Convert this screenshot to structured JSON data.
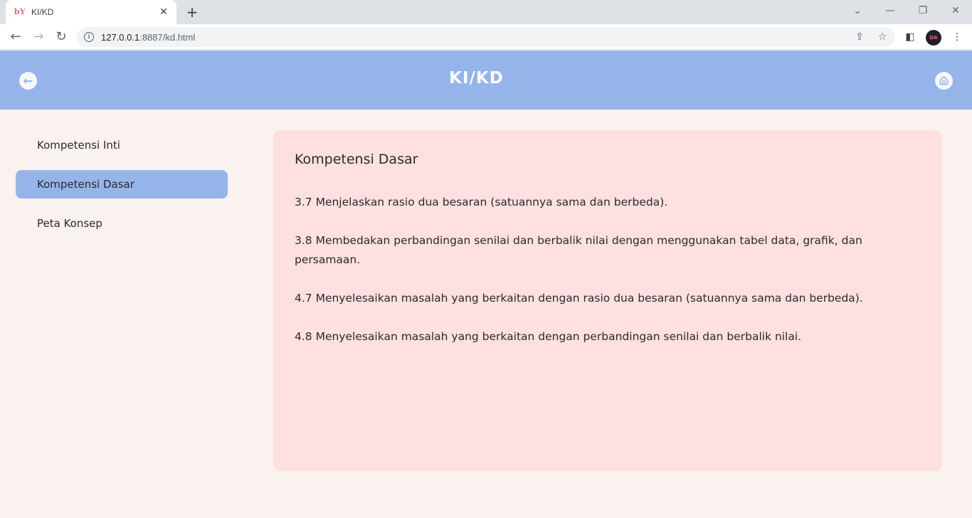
{
  "browser": {
    "tab_title": "KI/KD",
    "favicon_text": "bY",
    "url_host": "127.0.0.1",
    "url_rest": ":8887/kd.html",
    "profile_initials": "DA"
  },
  "header": {
    "title": "KI/KD"
  },
  "sidebar": {
    "items": [
      {
        "label": "Kompetensi Inti"
      },
      {
        "label": "Kompetensi Dasar"
      },
      {
        "label": "Peta Konsep"
      }
    ]
  },
  "content": {
    "title": "Kompetensi Dasar",
    "items": [
      {
        "text": "3.7 Menjelaskan rasio dua besaran (satuannya sama dan berbeda)."
      },
      {
        "text": "3.8 Membedakan perbandingan senilai dan berbalik nilai dengan menggunakan tabel data, grafik, dan persamaan."
      },
      {
        "text": "4.7 Menyelesaikan masalah yang berkaitan dengan rasio dua besaran (satuannya sama dan berbeda)."
      },
      {
        "text": "4.8 Menyelesaikan masalah yang berkaitan dengan perbandingan senilai dan berbalik nilai."
      }
    ]
  },
  "colors": {
    "header_bg": "#95b4ea",
    "page_bg": "#faf2ee",
    "card_bg": "#fde0df",
    "active_item_bg": "#95b4ea"
  }
}
